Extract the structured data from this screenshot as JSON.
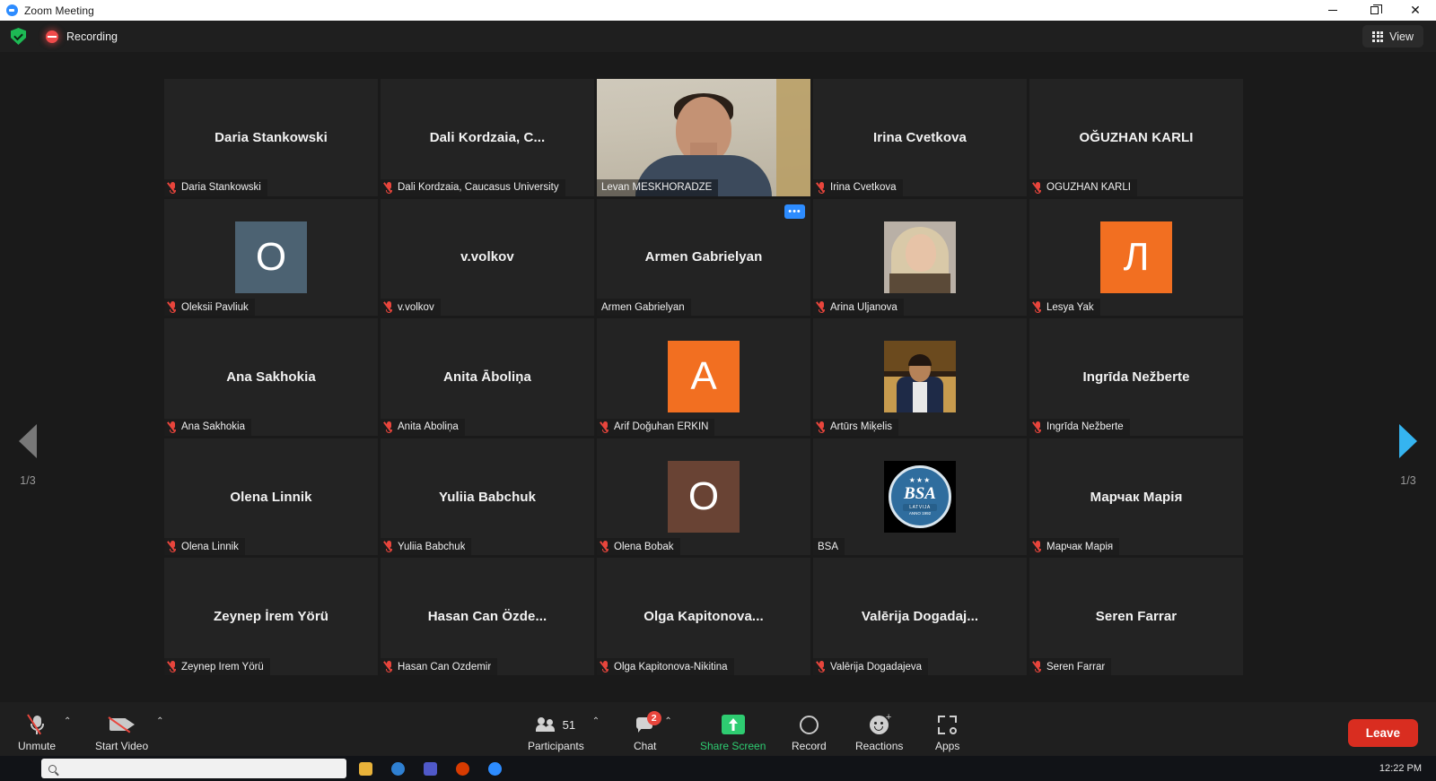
{
  "window": {
    "title": "Zoom Meeting",
    "minimize": "—",
    "maximize": "❐",
    "close": "×"
  },
  "topbar": {
    "recording_label": "Recording",
    "view_label": "View",
    "shield_icon": "shield-encryption-icon",
    "record_icon": "recording-dot-icon",
    "grid_icon": "grid-view-icon"
  },
  "pagination": {
    "left_label": "1/3",
    "right_label": "1/3",
    "left_arrow_color": "#787878",
    "right_arrow_color": "#35b4f0"
  },
  "active_tile": {
    "name": "Levan MESKHORADZE",
    "border_color": "#d7e84a"
  },
  "tiles": [
    {
      "big_name": "Daria Stankowski",
      "bar_name": "Daria Stankowski",
      "muted": true,
      "kind": "name"
    },
    {
      "big_name": "Dali Kordzaia, C...",
      "bar_name": "Dali Kordzaia, Caucasus University",
      "muted": true,
      "kind": "name"
    },
    {
      "big_name": "",
      "bar_name": "Levan MESKHORADZE",
      "muted": false,
      "kind": "video",
      "active": true
    },
    {
      "big_name": "Irina Cvetkova",
      "bar_name": "Irina Cvetkova",
      "muted": true,
      "kind": "name"
    },
    {
      "big_name": "OĞUZHAN KARLI",
      "bar_name": "OĞUZHAN KARLI",
      "muted": true,
      "kind": "name"
    },
    {
      "big_name": "",
      "bar_name": "Oleksii Pavliuk",
      "muted": true,
      "kind": "initial",
      "initial": "O",
      "avatar_color": "#4c6272"
    },
    {
      "big_name": "v.volkov",
      "bar_name": "v.volkov",
      "muted": true,
      "kind": "name"
    },
    {
      "big_name": "Armen Gabrielyan",
      "bar_name": "Armen Gabrielyan",
      "muted": false,
      "kind": "name",
      "more_menu": "•••"
    },
    {
      "big_name": "",
      "bar_name": "Arina Uljanova",
      "muted": true,
      "kind": "photo",
      "photo": "arina-portrait"
    },
    {
      "big_name": "",
      "bar_name": "Lesya Yak",
      "muted": true,
      "kind": "initial",
      "initial": "Л",
      "avatar_color": "#f26f21"
    },
    {
      "big_name": "Ana Sakhokia",
      "bar_name": "Ana Sakhokia",
      "muted": true,
      "kind": "name"
    },
    {
      "big_name": "Anita Āboliņa",
      "bar_name": "Anita Āboliņa",
      "muted": true,
      "kind": "name"
    },
    {
      "big_name": "",
      "bar_name": "Arif Doğuhan ERKİN",
      "muted": true,
      "kind": "initial",
      "initial": "A",
      "avatar_color": "#f26f21"
    },
    {
      "big_name": "",
      "bar_name": "Artūrs Miķelis",
      "muted": true,
      "kind": "photo",
      "photo": "arturs-portrait"
    },
    {
      "big_name": "Ingrīda Nežberte",
      "bar_name": "Ingrīda Nežberte",
      "muted": true,
      "kind": "name"
    },
    {
      "big_name": "Olena Linnik",
      "bar_name": "Olena Linnik",
      "muted": true,
      "kind": "name"
    },
    {
      "big_name": "Yuliia Babchuk",
      "bar_name": "Yuliia Babchuk",
      "muted": true,
      "kind": "name"
    },
    {
      "big_name": "",
      "bar_name": "Olena Bobak",
      "muted": true,
      "kind": "initial",
      "initial": "O",
      "avatar_color": "#694334"
    },
    {
      "big_name": "",
      "bar_name": "BSA",
      "muted": false,
      "kind": "logo",
      "logo": "bsa-latvija-logo"
    },
    {
      "big_name": "Марчак Марія",
      "bar_name": "Марчак Марія",
      "muted": true,
      "kind": "name"
    },
    {
      "big_name": "Zeynep İrem Yörü",
      "bar_name": "Zeynep İrem Yörü",
      "muted": true,
      "kind": "name"
    },
    {
      "big_name": "Hasan Can Özde...",
      "bar_name": "Hasan Can Özdemir",
      "muted": true,
      "kind": "name"
    },
    {
      "big_name": "Olga  Kapitonova...",
      "bar_name": "Olga Kapitonova-Nikitina",
      "muted": true,
      "kind": "name"
    },
    {
      "big_name": "Valērija  Dogadaj...",
      "bar_name": "Valērija Dogadajeva",
      "muted": true,
      "kind": "name"
    },
    {
      "big_name": "Seren Farrar",
      "bar_name": "Seren Farrar",
      "muted": true,
      "kind": "name"
    }
  ],
  "bsa_logo": {
    "stars": "★★★",
    "letters": "BSA",
    "country": "LATVIJA",
    "anno": "ANNO 1992"
  },
  "toolbar": {
    "unmute_label": "Unmute",
    "start_video_label": "Start Video",
    "participants_label": "Participants",
    "participants_count": "51",
    "chat_label": "Chat",
    "chat_badge": "2",
    "share_label": "Share Screen",
    "record_label": "Record",
    "reactions_label": "Reactions",
    "apps_label": "Apps",
    "leave_label": "Leave",
    "caret": "⌃",
    "share_color": "#2ecc71",
    "leave_color": "#d92d20"
  },
  "taskbar": {
    "clock_time": "12:22 PM"
  }
}
